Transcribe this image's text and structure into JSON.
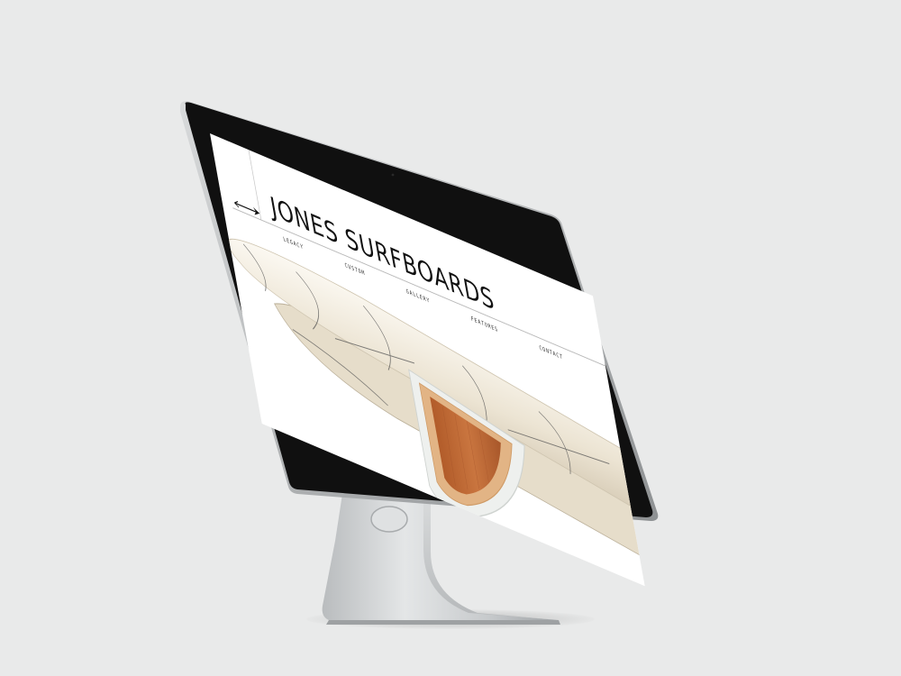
{
  "site": {
    "brand": "JONES SURFBOARDS",
    "nav": [
      "LEGACY",
      "CUSTOM",
      "GALLERY",
      "FEATURES",
      "CONTACT"
    ]
  },
  "icons": {
    "logo_mark": "arrow-icon",
    "device_logo": "apple-icon"
  },
  "colors": {
    "background": "#e9eaea",
    "bezel": "#101010",
    "fin_wood": "#c26a34",
    "board": "#f3eee3"
  }
}
